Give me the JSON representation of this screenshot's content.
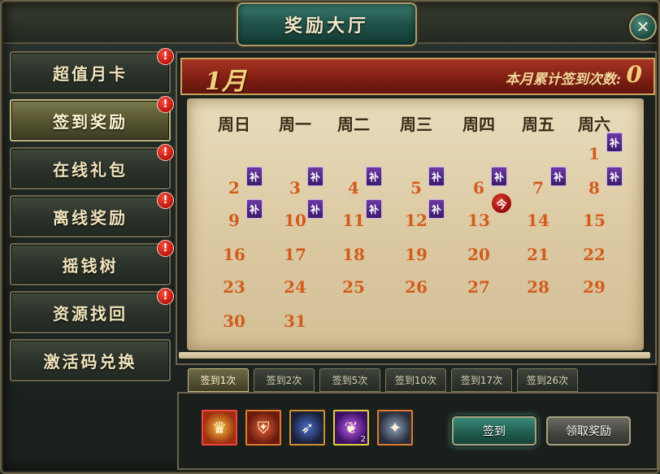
{
  "window": {
    "title": "奖励大厅",
    "close_symbol": "✕"
  },
  "menu": [
    {
      "label": "超值月卡",
      "alert": "!"
    },
    {
      "label": "签到奖励",
      "alert": "!",
      "active": true
    },
    {
      "label": "在线礼包",
      "alert": "!"
    },
    {
      "label": "离线奖励",
      "alert": "!"
    },
    {
      "label": "摇钱树",
      "alert": "!"
    },
    {
      "label": "资源找回",
      "alert": "!"
    },
    {
      "label": "激活码兑换"
    }
  ],
  "calendar": {
    "month": "1月",
    "total_label": "本月累计签到次数:",
    "total_value": "0",
    "weekdays": [
      "周日",
      "周一",
      "周二",
      "周三",
      "周四",
      "周五",
      "周六"
    ],
    "first_weekday_index": 6,
    "days_in_month": 31,
    "makeup_label": "补",
    "makeup_days": [
      1,
      2,
      3,
      4,
      5,
      6,
      7,
      8,
      9,
      10,
      11,
      12
    ],
    "today_label": "今",
    "today": 13
  },
  "tabs": [
    {
      "label": "签到1次",
      "active": true
    },
    {
      "label": "签到2次"
    },
    {
      "label": "签到5次"
    },
    {
      "label": "签到10次"
    },
    {
      "label": "签到17次"
    },
    {
      "label": "签到26次"
    }
  ],
  "rewards": [
    {
      "icon": "gold-crown-icon",
      "count": ""
    },
    {
      "icon": "red-shield-icon",
      "count": ""
    },
    {
      "icon": "blue-blade-icon",
      "count": ""
    },
    {
      "icon": "purple-feather-icon",
      "count": "2"
    },
    {
      "icon": "spirit-armor-icon",
      "count": ""
    }
  ],
  "buttons": {
    "sign_in": "签到",
    "claim": "领取奖励"
  },
  "colors": {
    "accent_red": "#a73422",
    "day_number": "#d35c1d",
    "makeup_purple": "#6c3aa3",
    "teal_button": "#3a8a77"
  }
}
